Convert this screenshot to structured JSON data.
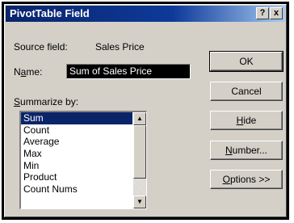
{
  "window": {
    "title": "PivotTable Field",
    "help_button": "?",
    "close_button": "x"
  },
  "source_field": {
    "label": "Source field:",
    "value": "Sales Price"
  },
  "name": {
    "label_prefix": "N",
    "label_underline": "a",
    "label_suffix": "me:",
    "value": "Sum of Sales Price"
  },
  "summarize": {
    "label_underline": "S",
    "label_suffix": "ummarize by:",
    "items": [
      "Sum",
      "Count",
      "Average",
      "Max",
      "Min",
      "Product",
      "Count Nums"
    ],
    "selected": "Sum"
  },
  "buttons": {
    "ok": "OK",
    "cancel": "Cancel",
    "hide_underline": "H",
    "hide_suffix": "ide",
    "number_underline": "N",
    "number_suffix": "umber...",
    "options_underline": "O",
    "options_suffix": "ptions >>"
  }
}
